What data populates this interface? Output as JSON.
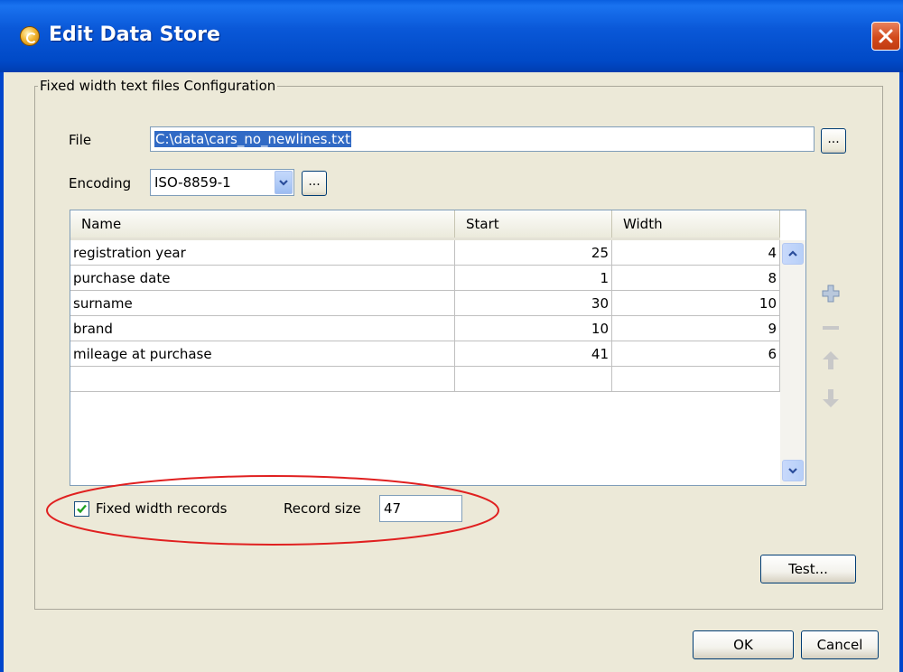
{
  "window": {
    "title": "Edit Data Store"
  },
  "group": {
    "title": "Fixed width text files Configuration"
  },
  "file": {
    "label": "File",
    "value": "C:\\data\\cars_no_newlines.txt",
    "browse_label": "..."
  },
  "encoding": {
    "label": "Encoding",
    "value": "ISO-8859-1",
    "browse_label": "..."
  },
  "table": {
    "columns": [
      "Name",
      "Start",
      "Width"
    ],
    "rows": [
      {
        "name": "registration year",
        "start": "25",
        "width": "4"
      },
      {
        "name": "purchase date",
        "start": "1",
        "width": "8"
      },
      {
        "name": "surname",
        "start": "30",
        "width": "10"
      },
      {
        "name": "brand",
        "start": "10",
        "width": "9"
      },
      {
        "name": "mileage at purchase",
        "start": "41",
        "width": "6"
      }
    ]
  },
  "fixed_width": {
    "label": "Fixed width records",
    "checked": true
  },
  "record_size": {
    "label": "Record size",
    "value": "47"
  },
  "buttons": {
    "test": "Test...",
    "ok": "OK",
    "cancel": "Cancel"
  },
  "colors": {
    "title_bar": "#0a58d8",
    "highlight_ellipse": "#e02020",
    "selection": "#316ac5"
  }
}
